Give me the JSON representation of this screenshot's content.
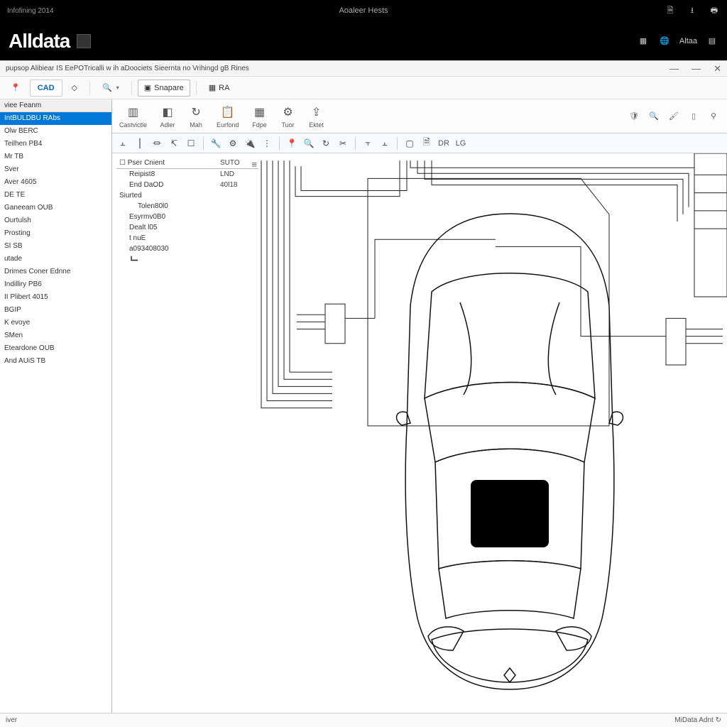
{
  "topbar": {
    "left": "Infofining 2014",
    "center": "Aoaleer Hests"
  },
  "brand": {
    "name": "Alldata",
    "right_label": "Altaa"
  },
  "window": {
    "title": "pupsop Alibiear IS EePOTricalli w ih aDoociets Sieernta no Vrihingd gB Rines"
  },
  "toolbar1": {
    "cad_tab": "CAD",
    "snapare": "Snapare",
    "ra": "RA"
  },
  "sidebar": {
    "header": "viee Feanm",
    "items": [
      "IntBULDBU RAbs",
      "Olw BERC",
      "Teilhen PB4",
      "Mr TB",
      "Sver",
      "Aver 4605",
      "DE TE",
      "Ganeeam OUB",
      "Ourtulsh",
      "Prosting",
      "SI SB",
      "utade",
      "Drimes Coner Ednne",
      "Indilliry PB6",
      "II Plibert 4015",
      "BGIP",
      "K evoye",
      "SMen",
      "Eteardone OUB",
      "And AUiS TB"
    ],
    "selected_index": 0
  },
  "ribbon": {
    "items": [
      {
        "label": "Castvictle"
      },
      {
        "label": "Adler"
      },
      {
        "label": "Mah"
      },
      {
        "label": "Eurfond"
      },
      {
        "label": "Fdpe"
      },
      {
        "label": "Tuor"
      },
      {
        "label": "Ektet"
      }
    ]
  },
  "toolstrip": {
    "dr": "DR",
    "lg": "LG"
  },
  "props": {
    "header": {
      "label": "Pser Cnient",
      "value": "SUTO"
    },
    "rows": [
      {
        "label": "Reipist8",
        "value": "LND",
        "indent": 1
      },
      {
        "label": "End DaOD",
        "value": "40l18",
        "indent": 1
      },
      {
        "label": "Siurted",
        "value": "",
        "indent": 0
      },
      {
        "label": "Tolen80l0",
        "value": "",
        "indent": 2
      },
      {
        "label": "Esyrmv0B0",
        "value": "",
        "indent": 1
      },
      {
        "label": "Dealt l05",
        "value": "",
        "indent": 1
      },
      {
        "label": "t nuE",
        "value": "",
        "indent": 1
      },
      {
        "label": "a093408030",
        "value": "",
        "indent": 1
      }
    ]
  },
  "statusbar": {
    "left": "iver",
    "right": "MiData Adnt ↻"
  }
}
